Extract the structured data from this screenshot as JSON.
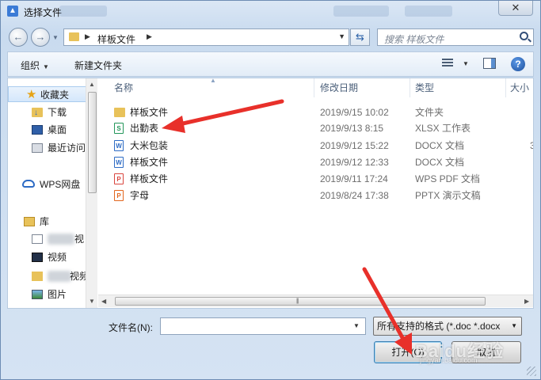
{
  "window": {
    "title": "选择文件",
    "close_glyph": "✕"
  },
  "address_bar": {
    "path": [
      "样板文件"
    ],
    "search_placeholder": "搜索 样板文件"
  },
  "toolbar": {
    "organize_label": "组织",
    "new_folder_label": "新建文件夹",
    "help_glyph": "?"
  },
  "nav_pane": {
    "items": [
      {
        "label": "收藏夹",
        "icon": "star-icon",
        "selected": true
      },
      {
        "label": "下载",
        "icon": "downloads-folder-icon"
      },
      {
        "label": "桌面",
        "icon": "desktop-icon"
      },
      {
        "label": "最近访问",
        "icon": "recent-places-icon"
      },
      {
        "label": "WPS网盘",
        "icon": "cloud-icon"
      },
      {
        "label": "库",
        "icon": "library-icon"
      },
      {
        "label": "视",
        "icon": "document-icon",
        "partially_obscured": true
      },
      {
        "label": "视频",
        "icon": "video-icon"
      },
      {
        "label": "视频",
        "icon": "music-icon",
        "partially_obscured": true
      },
      {
        "label": "图片",
        "icon": "pictures-icon"
      }
    ]
  },
  "file_list": {
    "columns": [
      "名称",
      "修改日期",
      "类型",
      "大小"
    ],
    "rows": [
      {
        "name": "样板文件",
        "modified": "2019/9/15 10:02",
        "type": "文件夹",
        "size": "",
        "icon": "folder-icon"
      },
      {
        "name": "出勤表",
        "modified": "2019/9/13 8:15",
        "type": "XLSX 工作表",
        "size": "",
        "icon": "xlsx-file-icon"
      },
      {
        "name": "大米包装",
        "modified": "2019/9/12 15:22",
        "type": "DOCX 文档",
        "size": "3",
        "icon": "docx-file-icon"
      },
      {
        "name": "样板文件",
        "modified": "2019/9/12 12:33",
        "type": "DOCX 文档",
        "size": "",
        "icon": "docx-file-icon"
      },
      {
        "name": "样板文件",
        "modified": "2019/9/11 17:24",
        "type": "WPS PDF 文档",
        "size": "",
        "icon": "pdf-file-icon"
      },
      {
        "name": "字母",
        "modified": "2019/8/24 17:38",
        "type": "PPTX 演示文稿",
        "size": "",
        "icon": "pptx-file-icon"
      }
    ]
  },
  "footer": {
    "filename_label": "文件名(N):",
    "filename_value": "",
    "filter_value": "所有支持的格式 (*.doc *.docx",
    "open_label": "打开(O)",
    "cancel_label": "取消"
  },
  "annotations": {
    "arrow_color": "#e8302a",
    "watermark": "Baidu经验",
    "watermark_sub": "jingyan.baidu.com"
  }
}
